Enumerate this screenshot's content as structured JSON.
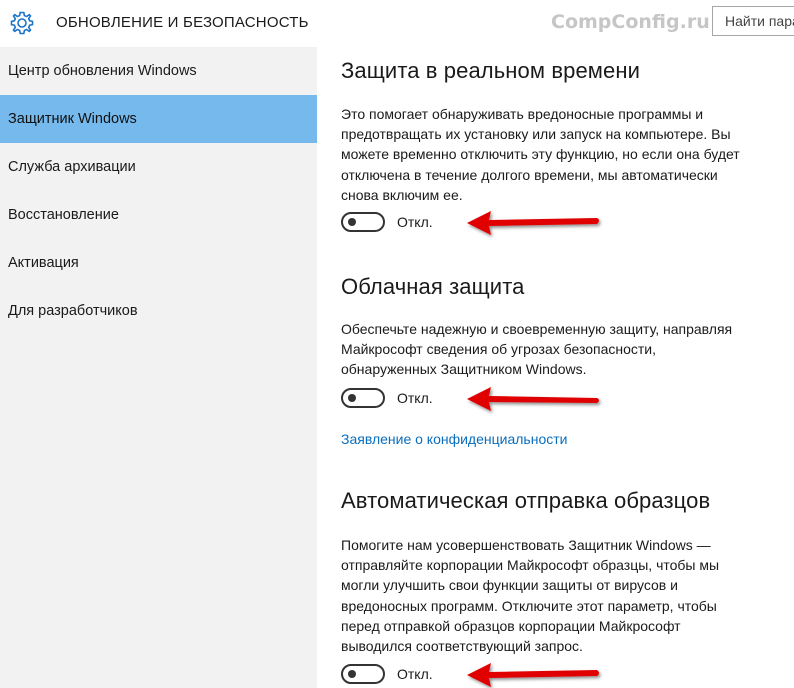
{
  "header": {
    "title": "ОБНОВЛЕНИЕ И БЕЗОПАСНОСТЬ",
    "watermark": "CompConfig.ru",
    "search_placeholder": "Найти пара",
    "settings_icon": "gear-icon"
  },
  "sidebar": {
    "items": [
      {
        "label": "Центр обновления Windows",
        "selected": false
      },
      {
        "label": "Защитник Windows",
        "selected": true
      },
      {
        "label": "Служба архивации",
        "selected": false
      },
      {
        "label": "Восстановление",
        "selected": false
      },
      {
        "label": "Активация",
        "selected": false
      },
      {
        "label": "Для разработчиков",
        "selected": false
      }
    ],
    "selected_color": "#76b9ed"
  },
  "sections": [
    {
      "title": "Защита в реальном времени",
      "description": [
        "Это помогает обнаруживать вредоносные программы и",
        "предотвращать их установку или запуск на компьютере. Вы",
        "можете временно отключить эту функцию, но если она будет",
        "отключена в течение долгого времени, мы автоматически",
        "снова включим ее."
      ],
      "toggle_state": "Откл."
    },
    {
      "title": "Облачная защита",
      "description": [
        "Обеспечьте надежную и своевременную защиту, направляя",
        "Майкрософт сведения об угрозах безопасности,",
        "обнаруженных Защитником Windows."
      ],
      "toggle_state": "Откл.",
      "link": "Заявление о конфиденциальности"
    },
    {
      "title": "Автоматическая отправка образцов",
      "description": [
        "Помогите нам усовершенствовать Защитник Windows —",
        "отправляйте корпорации Майкрософт образцы, чтобы мы",
        "могли улучшить свои функции защиты от вирусов и",
        "вредоносных программ. Отключите этот параметр, чтобы",
        "перед отправкой образцов корпорации Майкрософт",
        "выводился соответствующий запрос."
      ],
      "toggle_state": "Откл."
    }
  ],
  "colors": {
    "accent": "#0078d7",
    "link": "#0a6ebd",
    "annotation_arrow": "#e00000"
  }
}
